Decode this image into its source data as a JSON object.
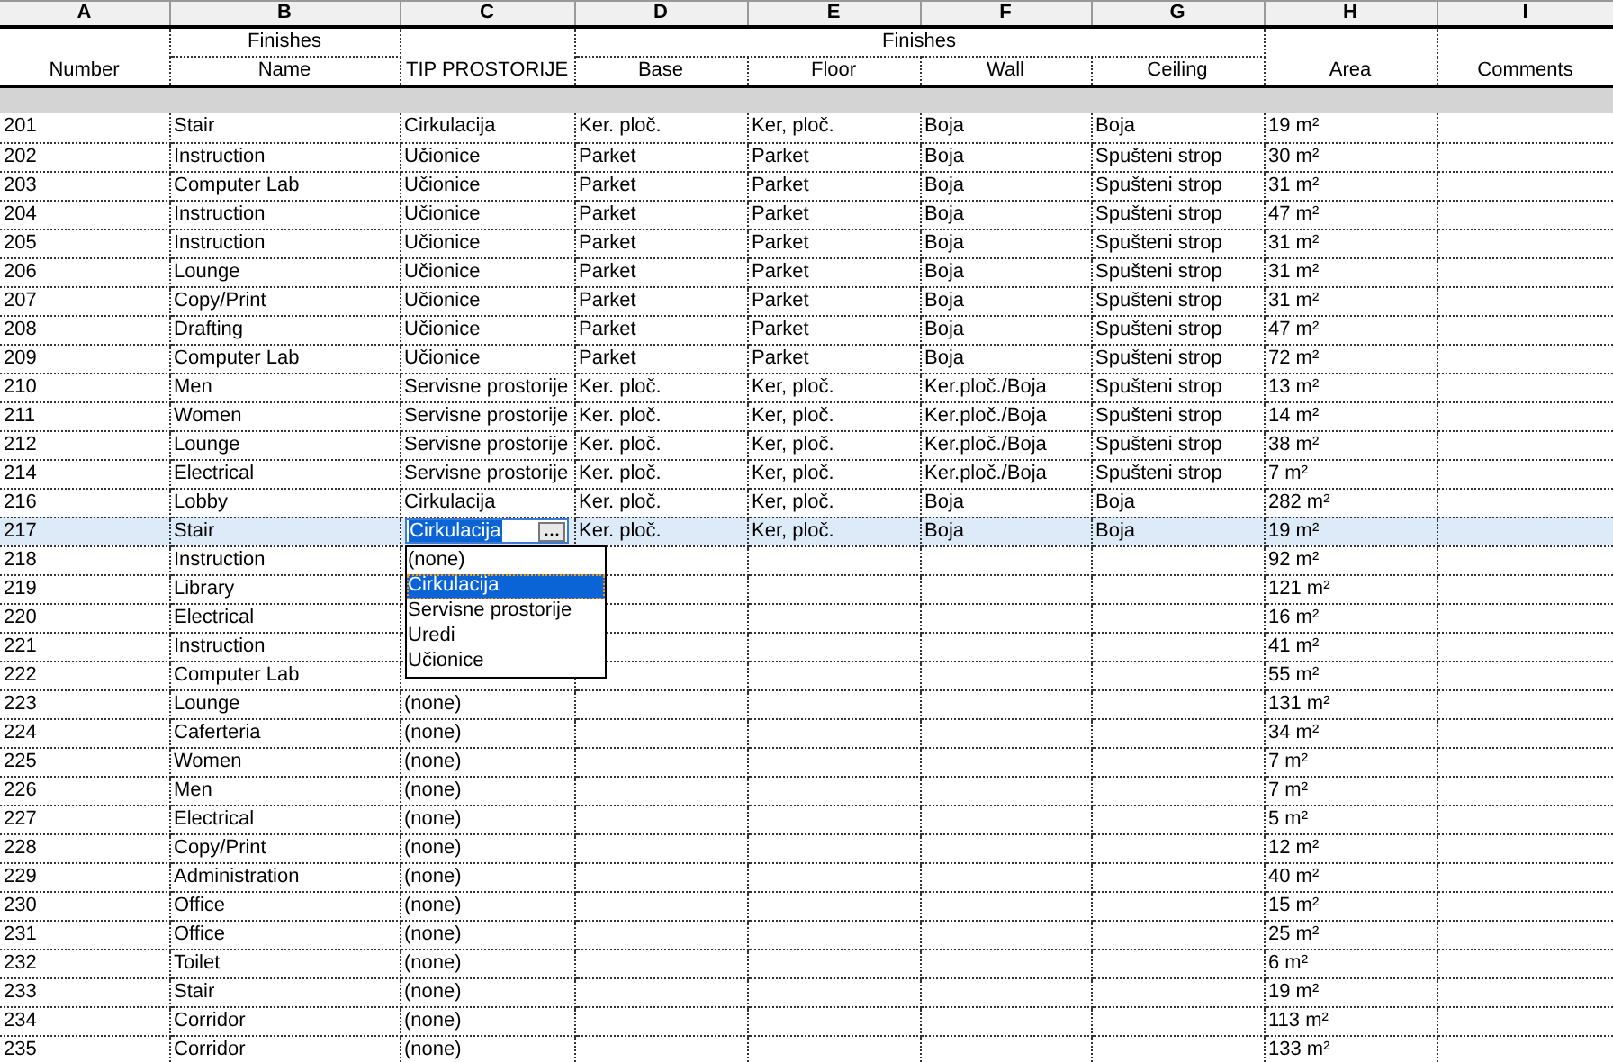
{
  "columns": [
    {
      "letter": "A",
      "heading": "Number"
    },
    {
      "group": "Finishes",
      "columns": [
        {
          "letter": "B",
          "heading": "Name"
        }
      ]
    },
    {
      "letter": "C",
      "heading": "TIP PROSTORIJE"
    },
    {
      "group": "Finishes",
      "columns": [
        {
          "letter": "D",
          "heading": "Base"
        },
        {
          "letter": "E",
          "heading": "Floor"
        },
        {
          "letter": "F",
          "heading": "Wall"
        },
        {
          "letter": "G",
          "heading": "Ceiling"
        }
      ]
    },
    {
      "letter": "H",
      "heading": "Area"
    },
    {
      "letter": "I",
      "heading": "Comments"
    }
  ],
  "rows": [
    {
      "number": "201",
      "name": "Stair",
      "type": "Cirkulacija",
      "base": "Ker. ploč.",
      "floor": "Ker, ploč.",
      "wall": "Boja",
      "ceiling": "Boja",
      "area": "19 m²",
      "selected": false
    },
    {
      "number": "202",
      "name": "Instruction",
      "type": "Učionice",
      "base": "Parket",
      "floor": "Parket",
      "wall": "Boja",
      "ceiling": "Spušteni strop",
      "area": "30 m²",
      "selected": false
    },
    {
      "number": "203",
      "name": "Computer Lab",
      "type": "Učionice",
      "base": "Parket",
      "floor": "Parket",
      "wall": "Boja",
      "ceiling": "Spušteni strop",
      "area": "31 m²",
      "selected": false
    },
    {
      "number": "204",
      "name": "Instruction",
      "type": "Učionice",
      "base": "Parket",
      "floor": "Parket",
      "wall": "Boja",
      "ceiling": "Spušteni strop",
      "area": "47 m²",
      "selected": false
    },
    {
      "number": "205",
      "name": "Instruction",
      "type": "Učionice",
      "base": "Parket",
      "floor": "Parket",
      "wall": "Boja",
      "ceiling": "Spušteni strop",
      "area": "31 m²",
      "selected": false
    },
    {
      "number": "206",
      "name": "Lounge",
      "type": "Učionice",
      "base": "Parket",
      "floor": "Parket",
      "wall": "Boja",
      "ceiling": "Spušteni strop",
      "area": "31 m²",
      "selected": false
    },
    {
      "number": "207",
      "name": "Copy/Print",
      "type": "Učionice",
      "base": "Parket",
      "floor": "Parket",
      "wall": "Boja",
      "ceiling": "Spušteni strop",
      "area": "31 m²",
      "selected": false
    },
    {
      "number": "208",
      "name": "Drafting",
      "type": "Učionice",
      "base": "Parket",
      "floor": "Parket",
      "wall": "Boja",
      "ceiling": "Spušteni strop",
      "area": "47 m²",
      "selected": false
    },
    {
      "number": "209",
      "name": "Computer Lab",
      "type": "Učionice",
      "base": "Parket",
      "floor": "Parket",
      "wall": "Boja",
      "ceiling": "Spušteni strop",
      "area": "72 m²",
      "selected": false
    },
    {
      "number": "210",
      "name": "Men",
      "type": "Servisne prostorije",
      "base": "Ker. ploč.",
      "floor": "Ker, ploč.",
      "wall": "Ker.ploč./Boja",
      "ceiling": "Spušteni strop",
      "area": "13 m²",
      "selected": false
    },
    {
      "number": "211",
      "name": "Women",
      "type": "Servisne prostorije",
      "base": "Ker. ploč.",
      "floor": "Ker, ploč.",
      "wall": "Ker.ploč./Boja",
      "ceiling": "Spušteni strop",
      "area": "14 m²",
      "selected": false
    },
    {
      "number": "212",
      "name": "Lounge",
      "type": "Servisne prostorije",
      "base": "Ker. ploč.",
      "floor": "Ker, ploč.",
      "wall": "Ker.ploč./Boja",
      "ceiling": "Spušteni strop",
      "area": "38 m²",
      "selected": false
    },
    {
      "number": "214",
      "name": "Electrical",
      "type": "Servisne prostorije",
      "base": "Ker. ploč.",
      "floor": "Ker, ploč.",
      "wall": "Ker.ploč./Boja",
      "ceiling": "Spušteni strop",
      "area": "7 m²",
      "selected": false
    },
    {
      "number": "216",
      "name": "Lobby",
      "type": "Cirkulacija",
      "base": "Ker. ploč.",
      "floor": "Ker, ploč.",
      "wall": "Boja",
      "ceiling": "Boja",
      "area": "282 m²",
      "selected": false
    },
    {
      "number": "217",
      "name": "Stair",
      "type": "Cirkulacija",
      "base": "Ker. ploč.",
      "floor": "Ker, ploč.",
      "wall": "Boja",
      "ceiling": "Boja",
      "area": "19 m²",
      "selected": true,
      "dropdown": {
        "options": [
          {
            "label": "(none)",
            "selected": false
          },
          {
            "label": "Cirkulacija",
            "selected": true
          },
          {
            "label": "Servisne prostorije",
            "selected": false
          },
          {
            "label": "Uredi",
            "selected": false
          },
          {
            "label": "Učionice",
            "selected": false
          }
        ]
      }
    },
    {
      "number": "218",
      "name": "Instruction",
      "area": "92 m²",
      "selected": false
    },
    {
      "number": "219",
      "name": "Library",
      "area": "121 m²",
      "selected": false
    },
    {
      "number": "220",
      "name": "Electrical",
      "area": "16 m²",
      "selected": false
    },
    {
      "number": "221",
      "name": "Instruction",
      "area": "41 m²",
      "selected": false
    },
    {
      "number": "222",
      "name": "Computer Lab",
      "area": "55 m²",
      "selected": false
    },
    {
      "number": "223",
      "name": "Lounge",
      "type": "(none)",
      "area": "131 m²",
      "selected": false
    },
    {
      "number": "224",
      "name": "Caferteria",
      "type": "(none)",
      "area": "34 m²",
      "selected": false
    },
    {
      "number": "225",
      "name": "Women",
      "type": "(none)",
      "area": "7 m²",
      "selected": false
    },
    {
      "number": "226",
      "name": "Men",
      "type": "(none)",
      "area": "7 m²",
      "selected": false
    },
    {
      "number": "227",
      "name": "Electrical",
      "type": "(none)",
      "area": "5 m²",
      "selected": false
    },
    {
      "number": "228",
      "name": "Copy/Print",
      "type": "(none)",
      "area": "12 m²",
      "selected": false
    },
    {
      "number": "229",
      "name": "Administration",
      "type": "(none)",
      "area": "40 m²",
      "selected": false
    },
    {
      "number": "230",
      "name": "Office",
      "type": "(none)",
      "area": "15 m²",
      "selected": false
    },
    {
      "number": "231",
      "name": "Office",
      "type": "(none)",
      "area": "25 m²",
      "selected": false
    },
    {
      "number": "232",
      "name": "Toilet",
      "type": "(none)",
      "area": "6 m²",
      "selected": false
    },
    {
      "number": "233",
      "name": "Stair",
      "type": "(none)",
      "area": "19 m²",
      "selected": false
    },
    {
      "number": "234",
      "name": "Corridor",
      "type": "(none)",
      "area": "113 m²",
      "selected": false
    },
    {
      "number": "235",
      "name": "Corridor",
      "type": "(none)",
      "area": "133 m²",
      "selected": false
    }
  ]
}
